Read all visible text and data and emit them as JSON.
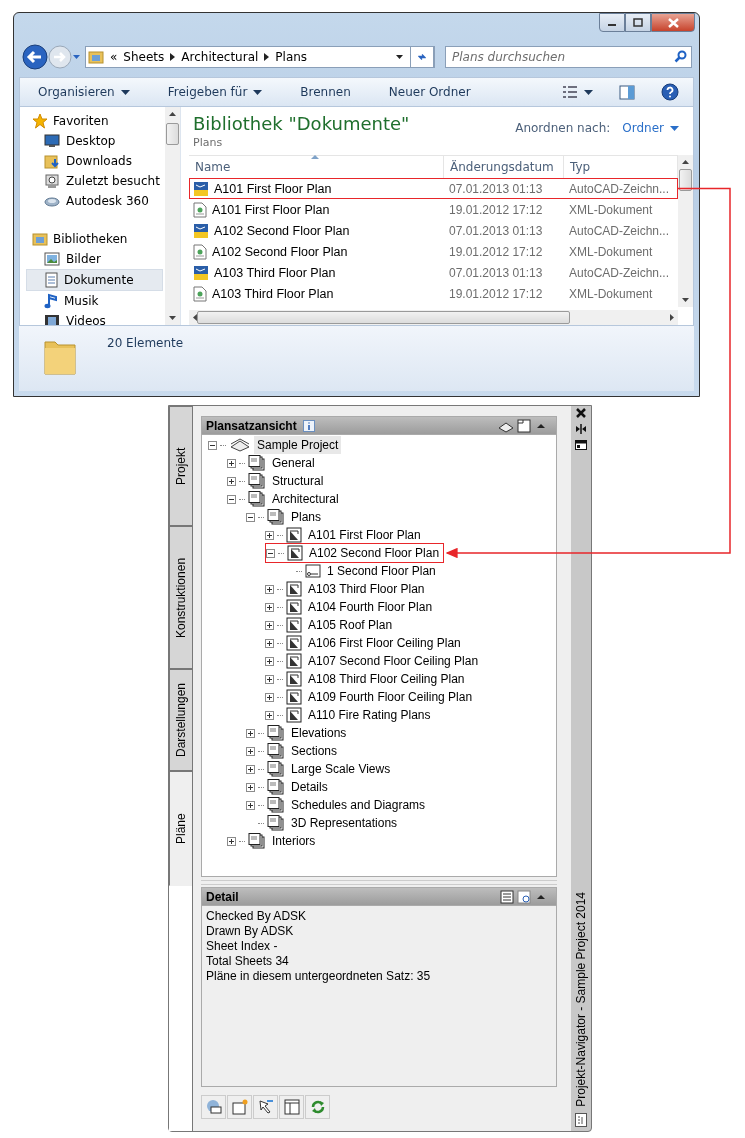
{
  "explorer": {
    "address_overflow": "«",
    "address_path": [
      "Sheets",
      "Architectural",
      "Plans"
    ],
    "search": {
      "placeholder": "Plans durchsuchen"
    },
    "toolbar": [
      {
        "label": "Organisieren",
        "dropdown": true
      },
      {
        "label": "Freigeben für",
        "dropdown": true
      },
      {
        "label": "Brennen",
        "dropdown": false
      },
      {
        "label": "Neuer Ordner",
        "dropdown": false
      }
    ],
    "sidebar": [
      {
        "label": "Favoriten",
        "kind": "star",
        "items": [
          {
            "label": "Desktop",
            "kind": "desktop",
            "selected": false
          },
          {
            "label": "Downloads",
            "kind": "downloads",
            "selected": false
          },
          {
            "label": "Zuletzt besucht",
            "kind": "recent",
            "selected": false
          },
          {
            "label": "Autodesk 360",
            "kind": "cloud",
            "selected": false
          }
        ]
      },
      {
        "label": "Bibliotheken",
        "kind": "library",
        "items": [
          {
            "label": "Bilder",
            "kind": "pictures",
            "selected": false
          },
          {
            "label": "Dokumente",
            "kind": "documents",
            "selected": true
          },
          {
            "label": "Musik",
            "kind": "music",
            "selected": false
          },
          {
            "label": "Videos",
            "kind": "videos",
            "selected": false
          }
        ]
      }
    ],
    "library_title": "Bibliothek \"Dokumente\"",
    "library_subtitle": "Plans",
    "arrange_label": "Anordnen nach:",
    "arrange_value": "Ordner",
    "columns": [
      "Name",
      "Änderungsdatum",
      "Typ"
    ],
    "rows": [
      {
        "name": "A101 First Floor Plan",
        "date": "07.01.2013 01:13",
        "type": "AutoCAD-Zeichn...",
        "kind": "dwg",
        "annotated": true
      },
      {
        "name": "A101 First Floor Plan",
        "date": "19.01.2012 17:12",
        "type": "XML-Dokument",
        "kind": "xml",
        "annotated": false
      },
      {
        "name": "A102 Second Floor Plan",
        "date": "07.01.2013 01:13",
        "type": "AutoCAD-Zeichn...",
        "kind": "dwg",
        "annotated": false
      },
      {
        "name": "A102 Second Floor Plan",
        "date": "19.01.2012 17:12",
        "type": "XML-Dokument",
        "kind": "xml",
        "annotated": false
      },
      {
        "name": "A103 Third Floor Plan",
        "date": "07.01.2013 01:13",
        "type": "AutoCAD-Zeichn...",
        "kind": "dwg",
        "annotated": false
      },
      {
        "name": "A103 Third Floor Plan",
        "date": "19.01.2012 17:12",
        "type": "XML-Dokument",
        "kind": "xml",
        "annotated": false
      }
    ],
    "status": "20 Elemente"
  },
  "navigator": {
    "tabs": [
      {
        "label": "Projekt",
        "selected": false
      },
      {
        "label": "Konstruktionen",
        "selected": false
      },
      {
        "label": "Darstellungen",
        "selected": false
      },
      {
        "label": "Pläne",
        "selected": true
      }
    ],
    "tree_title": "Plansatzansicht",
    "tree": [
      {
        "label": "Sample Project",
        "kind": "project",
        "expanded": true,
        "selected": true,
        "annotated": false,
        "children": [
          {
            "label": "General",
            "kind": "subset",
            "expanded": false,
            "selected": false,
            "annotated": false
          },
          {
            "label": "Structural",
            "kind": "subset",
            "expanded": false,
            "selected": false,
            "annotated": false
          },
          {
            "label": "Architectural",
            "kind": "subset",
            "expanded": true,
            "selected": false,
            "annotated": false,
            "children": [
              {
                "label": "Plans",
                "kind": "subset",
                "expanded": true,
                "selected": false,
                "annotated": false,
                "children": [
                  {
                    "label": "A101 First Floor Plan",
                    "kind": "sheet",
                    "expanded": false,
                    "selected": false,
                    "annotated": false
                  },
                  {
                    "label": "A102 Second Floor Plan",
                    "kind": "sheet",
                    "expanded": true,
                    "selected": false,
                    "annotated": true,
                    "children": [
                      {
                        "label": "1 Second Floor Plan",
                        "kind": "view",
                        "expanded": false,
                        "selected": false,
                        "annotated": false,
                        "leaf": true
                      }
                    ]
                  },
                  {
                    "label": "A103 Third Floor Plan",
                    "kind": "sheet",
                    "expanded": false,
                    "selected": false,
                    "annotated": false
                  },
                  {
                    "label": "A104 Fourth Floor Plan",
                    "kind": "sheet",
                    "expanded": false,
                    "selected": false,
                    "annotated": false
                  },
                  {
                    "label": "A105 Roof Plan",
                    "kind": "sheet",
                    "expanded": false,
                    "selected": false,
                    "annotated": false
                  },
                  {
                    "label": "A106 First Floor Ceiling Plan",
                    "kind": "sheet",
                    "expanded": false,
                    "selected": false,
                    "annotated": false
                  },
                  {
                    "label": "A107 Second Floor Ceiling Plan",
                    "kind": "sheet",
                    "expanded": false,
                    "selected": false,
                    "annotated": false
                  },
                  {
                    "label": "A108 Third Floor Ceiling Plan",
                    "kind": "sheet",
                    "expanded": false,
                    "selected": false,
                    "annotated": false
                  },
                  {
                    "label": "A109 Fourth Floor Ceiling Plan",
                    "kind": "sheet",
                    "expanded": false,
                    "selected": false,
                    "annotated": false
                  },
                  {
                    "label": "A110 Fire Rating Plans",
                    "kind": "sheet",
                    "expanded": false,
                    "selected": false,
                    "annotated": false
                  }
                ]
              },
              {
                "label": "Elevations",
                "kind": "subset",
                "expanded": false,
                "selected": false,
                "annotated": false
              },
              {
                "label": "Sections",
                "kind": "subset",
                "expanded": false,
                "selected": false,
                "annotated": false
              },
              {
                "label": "Large Scale Views",
                "kind": "subset",
                "expanded": false,
                "selected": false,
                "annotated": false
              },
              {
                "label": "Details",
                "kind": "subset",
                "expanded": false,
                "selected": false,
                "annotated": false
              },
              {
                "label": "Schedules and Diagrams",
                "kind": "subset",
                "expanded": false,
                "selected": false,
                "annotated": false
              },
              {
                "label": "3D Representations",
                "kind": "subset",
                "expanded": false,
                "selected": false,
                "annotated": false,
                "leaf": true
              }
            ]
          },
          {
            "label": "Interiors",
            "kind": "subset",
            "expanded": false,
            "selected": false,
            "annotated": false
          }
        ]
      }
    ],
    "detail_title": "Detail",
    "detail_lines": [
      "Checked By ADSK",
      "Drawn By ADSK",
      "Sheet Index -",
      "Total Sheets 34",
      "Pläne in diesem untergeordneten Satz: 35"
    ],
    "palette_title": "Projekt-Navigator - Sample Project 2014"
  }
}
